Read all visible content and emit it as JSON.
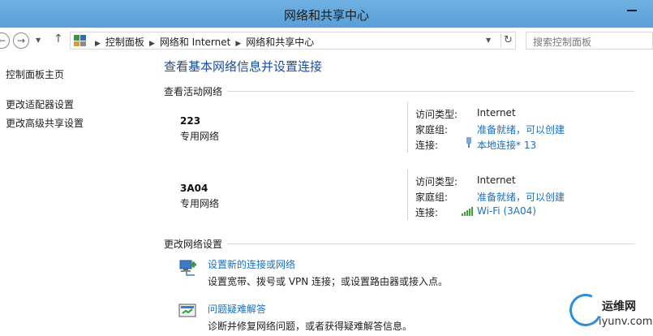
{
  "window": {
    "title": "网络和共享中心"
  },
  "address_bar": {
    "crumbs": [
      "控制面板",
      "网络和 Internet",
      "网络和共享中心"
    ],
    "search_placeholder": "搜索控制面板"
  },
  "sidebar": {
    "items": [
      {
        "label": "控制面板主页"
      },
      {
        "label": "更改适配器设置"
      },
      {
        "label": "更改高级共享设置"
      }
    ]
  },
  "main": {
    "title": "查看基本网络信息并设置连接",
    "active_header": "查看活动网络",
    "networks": [
      {
        "name": "223",
        "type": "专用网络",
        "access_label": "访问类型:",
        "access_value": "Internet",
        "homegroup_label": "家庭组:",
        "homegroup_value": "准备就绪，可以创建",
        "connection_label": "连接:",
        "connection_icon": "ethernet-icon",
        "connection_value": "本地连接* 13"
      },
      {
        "name": "3A04",
        "type": "专用网络",
        "access_label": "访问类型:",
        "access_value": "Internet",
        "homegroup_label": "家庭组:",
        "homegroup_value": "准备就绪，可以创建",
        "connection_label": "连接:",
        "connection_icon": "wifi-signal-icon",
        "connection_value": "Wi-Fi (3A04)"
      }
    ],
    "change_header": "更改网络设置",
    "tasks": [
      {
        "icon": "new-connection-icon",
        "title": "设置新的连接或网络",
        "desc": "设置宽带、拨号或 VPN 连接；或设置路由器或接入点。"
      },
      {
        "icon": "troubleshoot-icon",
        "title": "问题疑难解答",
        "desc": "诊断并修复网络问题，或者获得疑难解答信息。"
      }
    ]
  },
  "watermark": {
    "name": "运维网",
    "url": "iyunv.com"
  },
  "colors": {
    "titlebar": "#5a9fd8",
    "link": "#1a6fc2",
    "title": "#1a4ca0"
  }
}
